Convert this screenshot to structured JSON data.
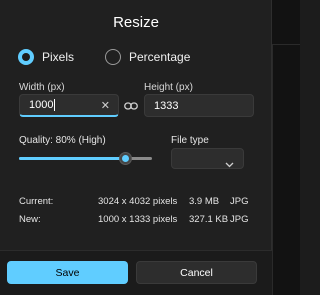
{
  "dialog": {
    "title": "Resize"
  },
  "mode": {
    "options": [
      {
        "label": "Pixels",
        "checked": true
      },
      {
        "label": "Percentage",
        "checked": false
      }
    ]
  },
  "width": {
    "label": "Width (px)",
    "value": "1000"
  },
  "height": {
    "label": "Height (px)",
    "value": "1333"
  },
  "aspect_lock_icon": "link-icon",
  "quality": {
    "label": "Quality: 80% (High)",
    "value_percent": 80
  },
  "file_type": {
    "label": "File type",
    "selected": ""
  },
  "info": {
    "current": {
      "label": "Current:",
      "dims": "3024 x 4032 pixels",
      "size": "3.9 MB",
      "type": "JPG"
    },
    "new": {
      "label": "New:",
      "dims": "1000 x 1333 pixels",
      "size": "327.1 KB",
      "type": "JPG"
    }
  },
  "buttons": {
    "save": "Save",
    "cancel": "Cancel"
  },
  "colors": {
    "accent": "#60cdff",
    "background": "#202020"
  }
}
